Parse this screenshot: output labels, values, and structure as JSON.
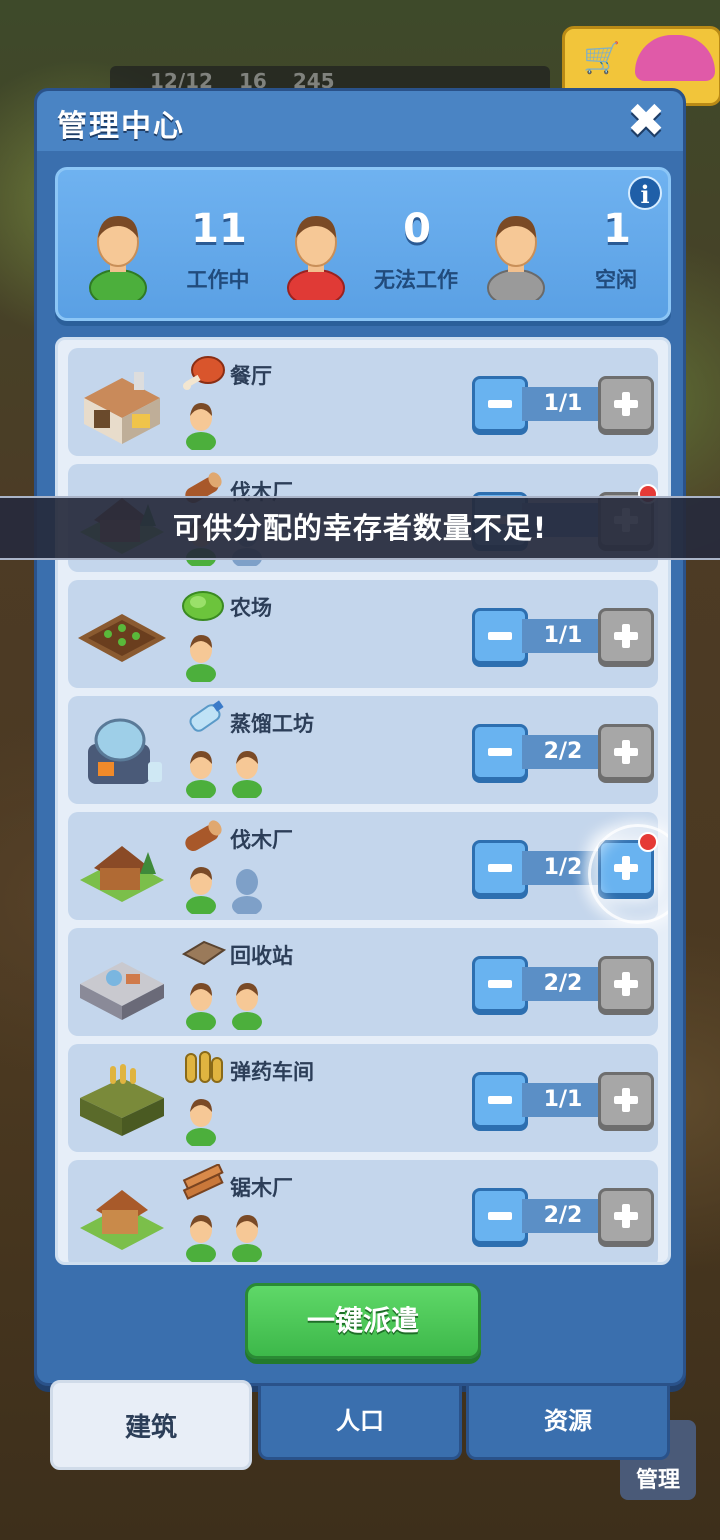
{
  "hud": {
    "workers": "12/12",
    "food": "16",
    "water": "245"
  },
  "background": {
    "manage_label": "管理"
  },
  "panel": {
    "title": "管理中心",
    "close_icon": "close-icon"
  },
  "summary": {
    "working": {
      "count": "11",
      "label": "工作中",
      "color": "#4caf3c"
    },
    "unable": {
      "count": "0",
      "label": "无法工作",
      "color": "#e03a36"
    },
    "idle": {
      "count": "1",
      "label": "空闲",
      "color": "#9a9a9a"
    }
  },
  "buildings": [
    {
      "name": "餐厅",
      "resource": "meat-icon",
      "count": "1/1",
      "workers": 1,
      "slots": 1
    },
    {
      "name": "伐木厂",
      "resource": "log-icon",
      "count": "",
      "workers": 1,
      "slots": 2
    },
    {
      "name": "农场",
      "resource": "lettuce-icon",
      "count": "1/1",
      "workers": 1,
      "slots": 1
    },
    {
      "name": "蒸馏工坊",
      "resource": "water-bottle-icon",
      "count": "2/2",
      "workers": 2,
      "slots": 2
    },
    {
      "name": "伐木厂",
      "resource": "log-icon",
      "count": "1/2",
      "workers": 1,
      "slots": 2
    },
    {
      "name": "回收站",
      "resource": "scrap-icon",
      "count": "2/2",
      "workers": 2,
      "slots": 2
    },
    {
      "name": "弹药车间",
      "resource": "ammo-icon",
      "count": "1/1",
      "workers": 1,
      "slots": 1
    },
    {
      "name": "锯木厂",
      "resource": "planks-icon",
      "count": "2/2",
      "workers": 2,
      "slots": 2
    }
  ],
  "toast": "可供分配的幸存者数量不足!",
  "dispatch_label": "一键派遣",
  "tabs": [
    {
      "label": "建筑",
      "selected": true
    },
    {
      "label": "人口",
      "selected": false
    },
    {
      "label": "资源",
      "selected": false
    }
  ],
  "colors": {
    "panel": "#3a6fae",
    "accent_blue": "#69b3f0",
    "green": "#3db84a",
    "worker_green": "#4caf3c"
  }
}
